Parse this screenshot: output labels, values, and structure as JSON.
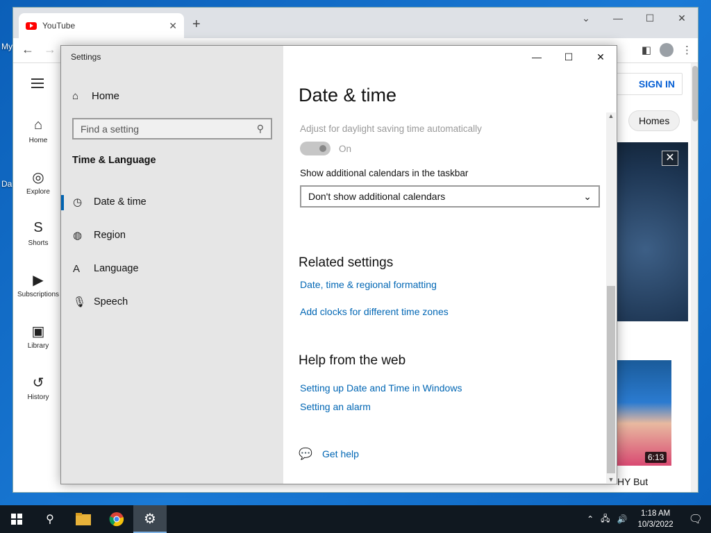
{
  "desktop": {
    "icon_labels": [
      "My",
      "Da"
    ]
  },
  "chrome": {
    "tab_title": "YouTube",
    "tab_close": "✕",
    "new_tab": "+",
    "win_minimize": "—",
    "win_maximize": "☐",
    "win_close": "✕",
    "back": "←",
    "forward": "→"
  },
  "youtube": {
    "nav": [
      {
        "label": "Home",
        "icon": "⌂"
      },
      {
        "label": "Explore",
        "icon": "◎"
      },
      {
        "label": "Shorts",
        "icon": "S"
      },
      {
        "label": "Subscriptions",
        "icon": "▶"
      },
      {
        "label": "Library",
        "icon": "▣"
      },
      {
        "label": "History",
        "icon": "↺"
      }
    ],
    "sign_in": "SIGN IN",
    "chip": "Homes",
    "video_duration": "6:13",
    "video_title_fragment": "HY But"
  },
  "settings": {
    "window_title": "Settings",
    "home": "Home",
    "search_placeholder": "Find a setting",
    "section": "Time & Language",
    "items": [
      {
        "label": "Date & time",
        "icon": "◷"
      },
      {
        "label": "Region",
        "icon": "◍"
      },
      {
        "label": "Language",
        "icon": "A"
      },
      {
        "label": "Speech",
        "icon": "🎙"
      }
    ],
    "page_title": "Date & time",
    "dst_label": "Adjust for daylight saving time automatically",
    "dst_state": "On",
    "calendars_label": "Show additional calendars in the taskbar",
    "calendars_value": "Don't show additional calendars",
    "related_heading": "Related settings",
    "related_links": [
      "Date, time & regional formatting",
      "Add clocks for different time zones"
    ],
    "help_heading": "Help from the web",
    "help_links": [
      "Setting up Date and Time in Windows",
      "Setting an alarm"
    ],
    "get_help": "Get help"
  },
  "taskbar": {
    "time": "1:18 AM",
    "date": "10/3/2022"
  }
}
